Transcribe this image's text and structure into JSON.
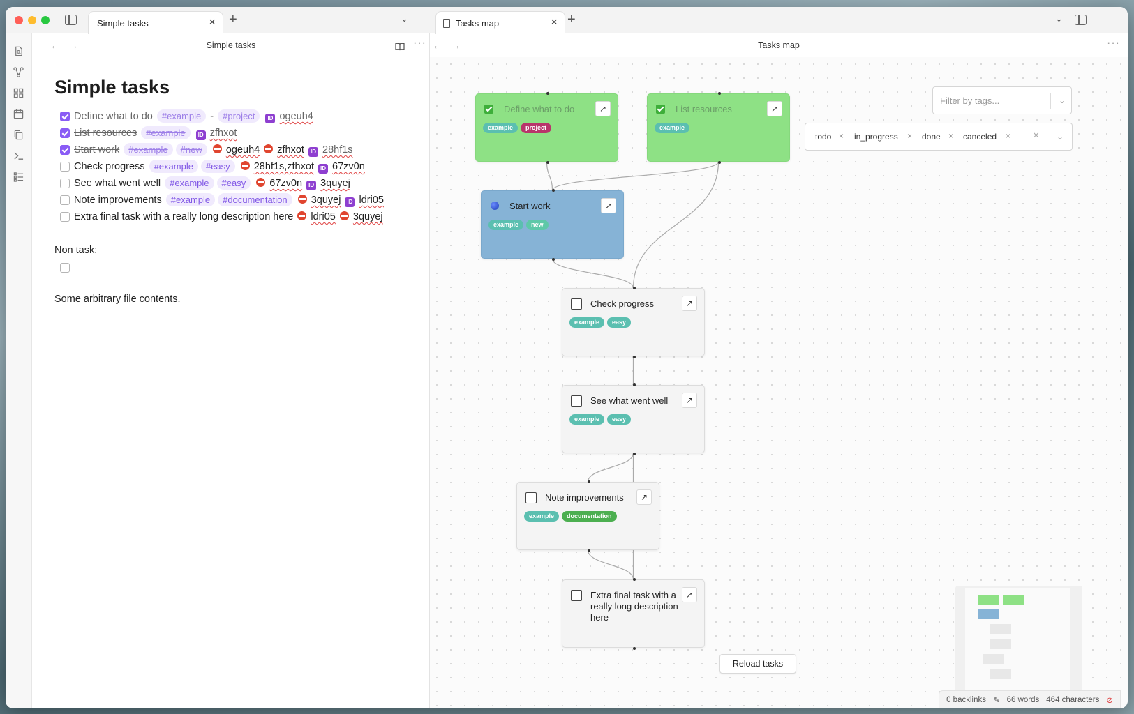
{
  "left": {
    "tab_title": "Simple tasks",
    "nav_title": "Simple tasks",
    "doc_title": "Simple tasks",
    "tasks": [
      {
        "done": true,
        "text": "Define what to do",
        "tags": [
          "#example",
          "#project"
        ],
        "sep": "-",
        "id": "ogeuh4"
      },
      {
        "done": true,
        "text": "List resources",
        "tags": [
          "#example"
        ],
        "id": "zfhxot"
      },
      {
        "done": true,
        "text": "Start work",
        "tags": [
          "#example",
          "#new"
        ],
        "blocked": [
          "ogeuh4",
          "zfhxot"
        ],
        "id": "28hf1s"
      },
      {
        "done": false,
        "text": "Check progress",
        "tags": [
          "#example",
          "#easy"
        ],
        "blocked": [
          "28hf1s,zfhxot"
        ],
        "id": "67zv0n"
      },
      {
        "done": false,
        "text": "See what went well",
        "tags": [
          "#example",
          "#easy"
        ],
        "blocked": [
          "67zv0n"
        ],
        "id": "3quyej"
      },
      {
        "done": false,
        "text": "Note improvements",
        "tags": [
          "#example",
          "#documentation"
        ],
        "blocked": [
          "3quyej"
        ],
        "id": "ldri05"
      },
      {
        "done": false,
        "text": "Extra final task with a really long description here",
        "tags": [],
        "blocked": [
          "ldri05",
          "3quyej"
        ]
      }
    ],
    "non_task_label": "Non task:",
    "file_contents": "Some arbitrary file contents.",
    "icons": {
      "id": "ID"
    }
  },
  "right": {
    "tab_title": "Tasks map",
    "nav_title": "Tasks map",
    "filter_placeholder": "Filter by tags...",
    "status_chips": [
      "todo",
      "in_progress",
      "done",
      "canceled"
    ],
    "reload_label": "Reload tasks",
    "nodes": [
      {
        "title": "Define what to do",
        "status": "done",
        "tags": [
          "example",
          "project"
        ]
      },
      {
        "title": "List resources",
        "status": "done",
        "tags": [
          "example"
        ]
      },
      {
        "title": "Start work",
        "status": "in_progress",
        "tags": [
          "example",
          "new"
        ]
      },
      {
        "title": "Check progress",
        "status": "todo",
        "tags": [
          "example",
          "easy"
        ]
      },
      {
        "title": "See what went well",
        "status": "todo",
        "tags": [
          "example",
          "easy"
        ]
      },
      {
        "title": "Note improvements",
        "status": "todo",
        "tags": [
          "example",
          "documentation"
        ]
      },
      {
        "title": "Extra final task with a really long description here",
        "status": "todo",
        "tags": []
      }
    ],
    "tag_colors": {
      "example": "#5bbfb0",
      "project": "#b8356a",
      "new": "#5ec8a8",
      "easy": "#5bbfb0",
      "documentation": "#4caf50"
    },
    "open_glyph": "↗"
  },
  "status_bar": {
    "backlinks": "0 backlinks",
    "words": "66 words",
    "characters": "464 characters"
  },
  "colors": {
    "accent": "#8a5cf5",
    "done_node": "#8ee185",
    "in_progress_node": "#86b3d6",
    "todo_node": "#f4f4f4"
  }
}
